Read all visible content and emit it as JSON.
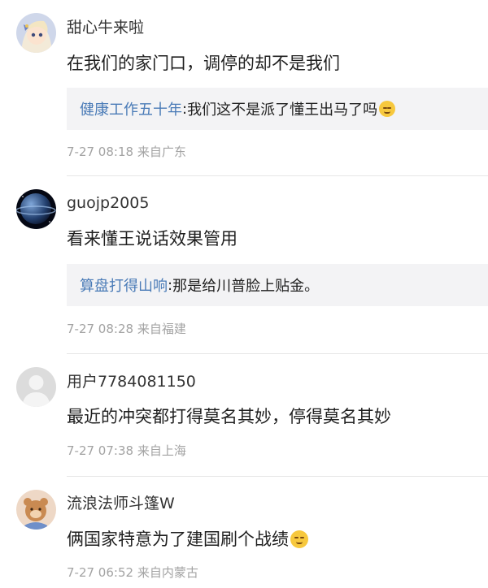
{
  "comments": [
    {
      "username": "甜心牛来啦",
      "text": "在我们的家门口，调停的却不是我们",
      "text_emoji": "",
      "reply": {
        "name": "健康工作五十年",
        "sep": ":",
        "text": "我们这不是派了懂王出马了吗",
        "emoji": "shush-emoji"
      },
      "time": "7-27 08:18",
      "location": "来自广东",
      "avatar": "anime-girl-avatar"
    },
    {
      "username": "guojp2005",
      "text": "看来懂王说话效果管用",
      "text_emoji": "",
      "reply": {
        "name": "算盘打得山响",
        "sep": ":",
        "text": "那是给川普脸上贴金。",
        "emoji": ""
      },
      "time": "7-27 08:28",
      "location": "来自福建",
      "avatar": "planet-avatar"
    },
    {
      "username": "用户7784081150",
      "text": "最近的冲突都打得莫名其妙，停得莫名其妙",
      "text_emoji": "",
      "reply": null,
      "time": "7-27 07:38",
      "location": "来自上海",
      "avatar": "default-user-avatar"
    },
    {
      "username": "流浪法师斗篷W",
      "text": "俩国家特意为了建国刷个战绩",
      "text_emoji": "relieved-emoji",
      "reply": null,
      "time": "7-27 06:52",
      "location": "来自内蒙古",
      "avatar": "cartoon-avatar"
    }
  ],
  "colors": {
    "reply_name": "#4a7bb7",
    "meta": "#a3a3a3",
    "quote_bg": "#f3f3f5",
    "divider": "#e6e6e6"
  }
}
